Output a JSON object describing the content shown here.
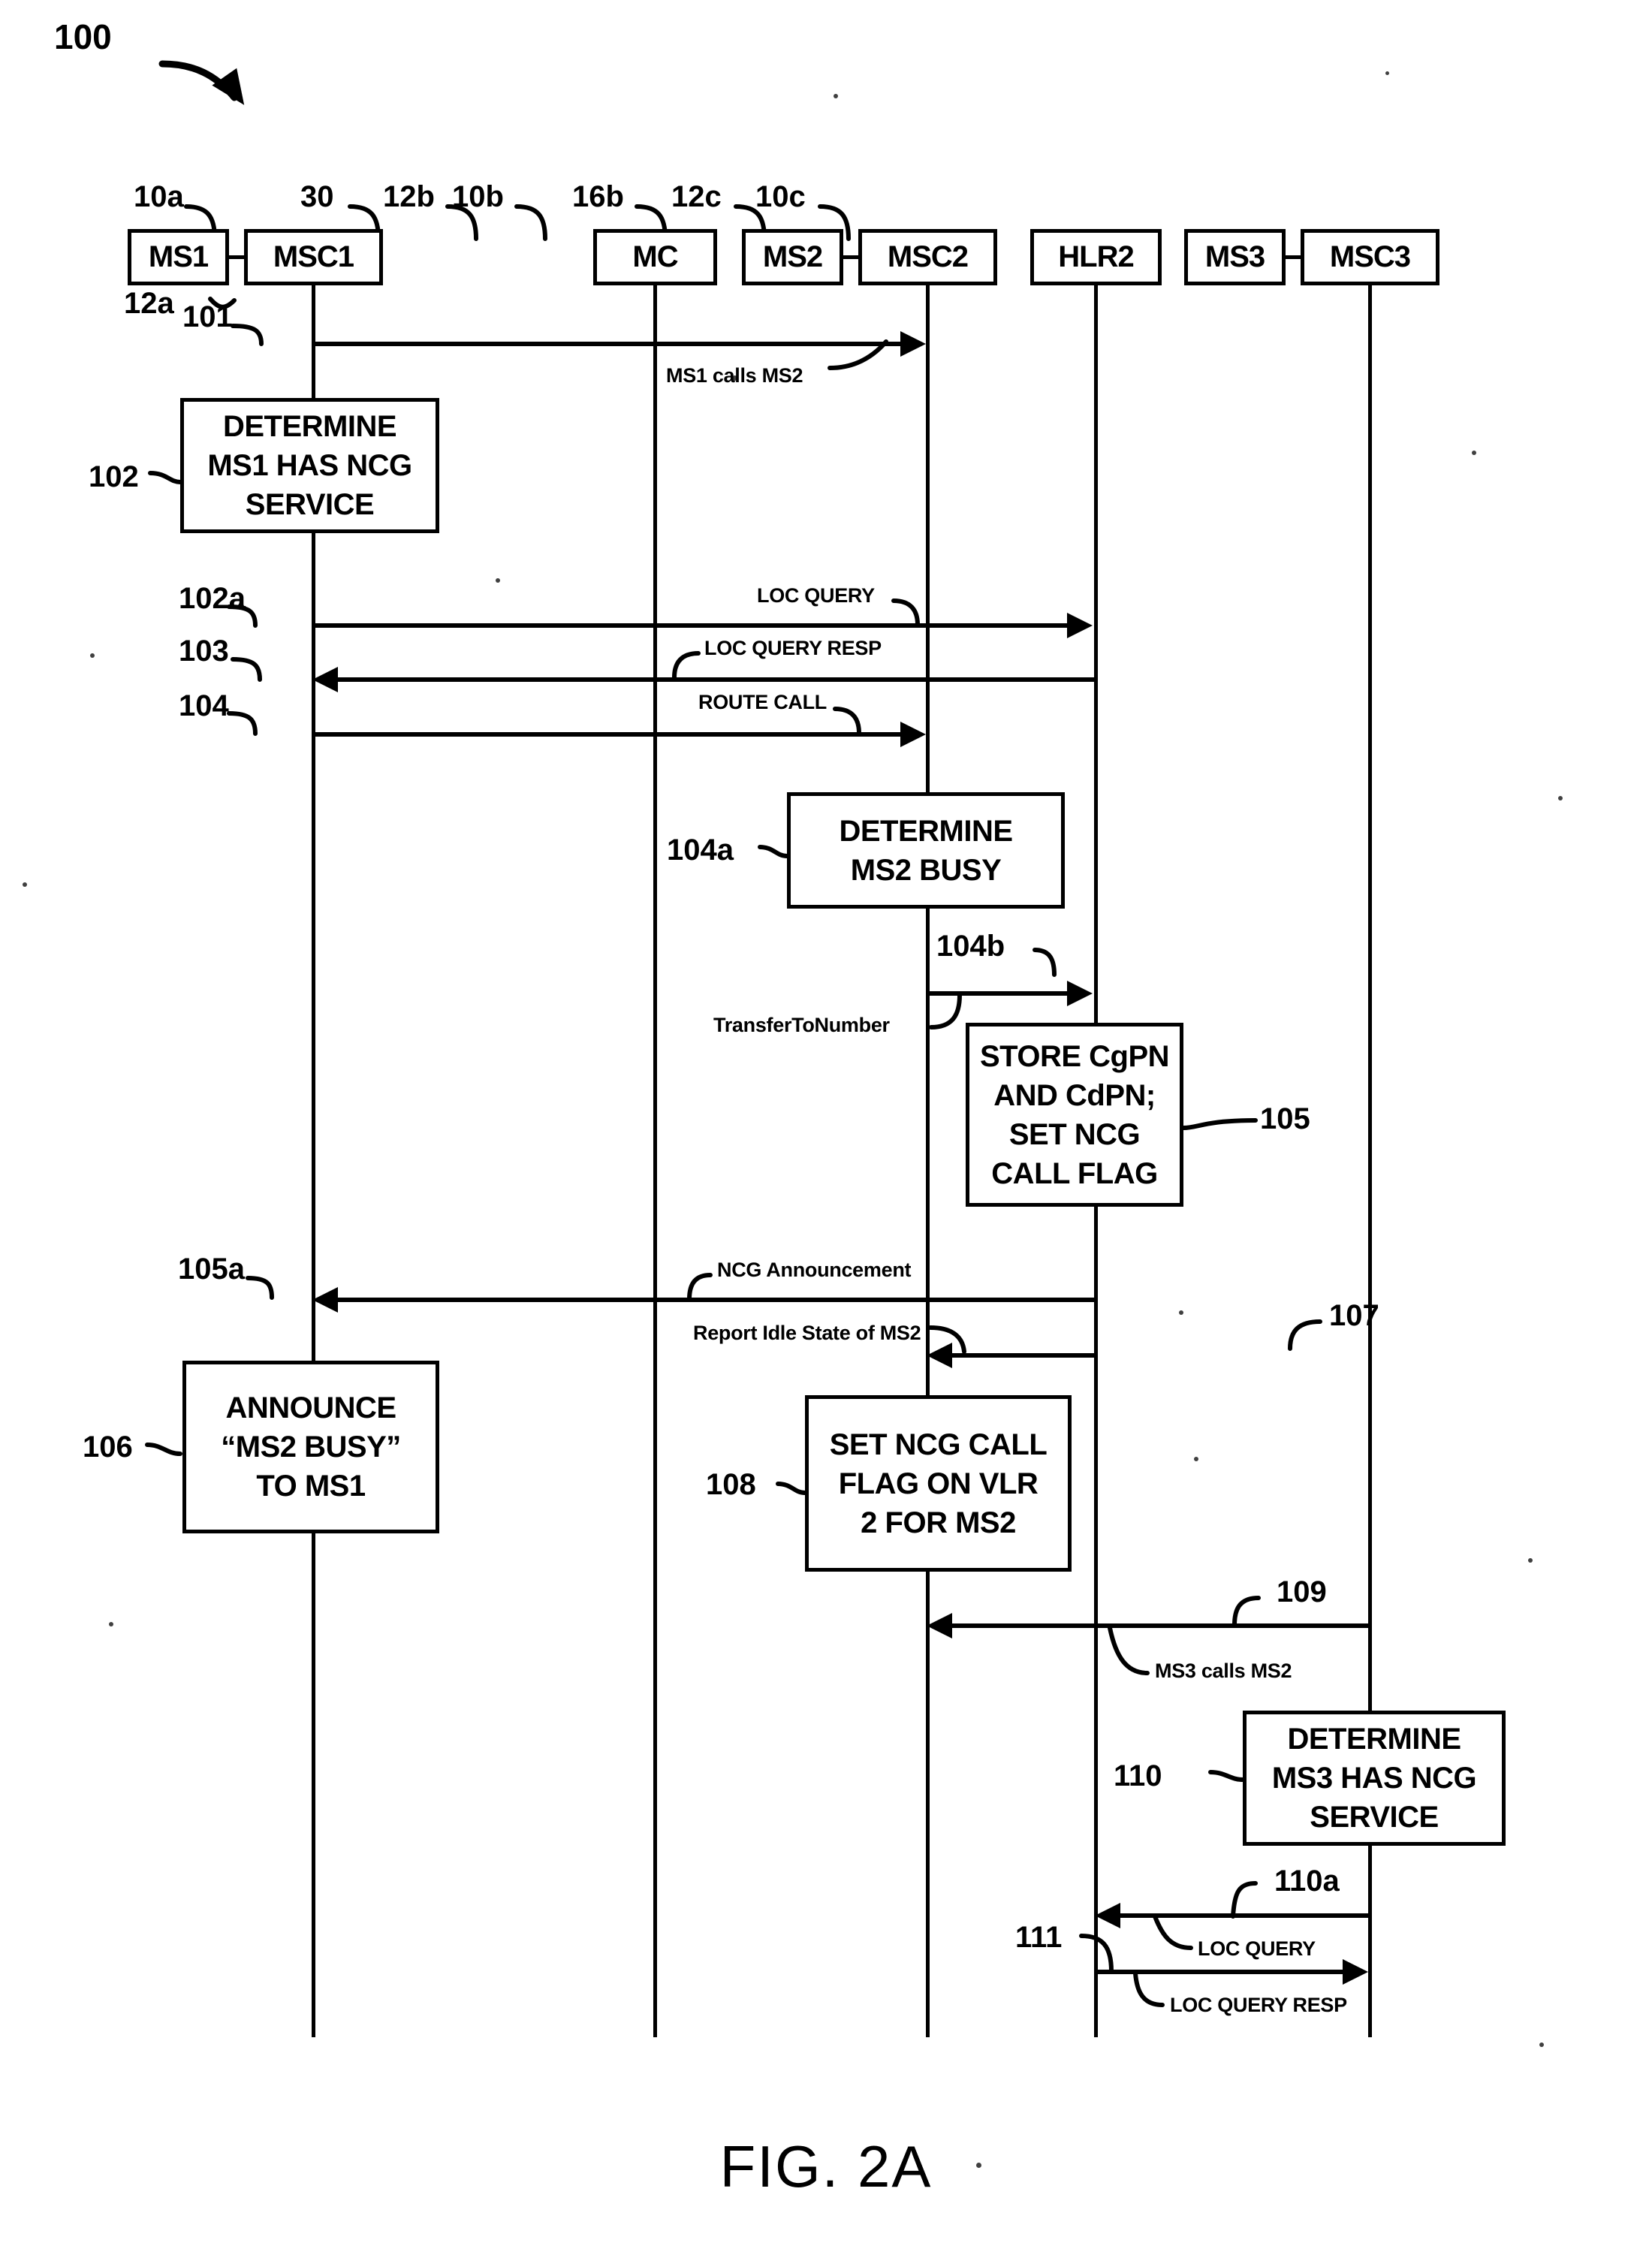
{
  "figure": {
    "caption": "FIG. 2A",
    "diagram_ref": "100",
    "type": "sequence-diagram"
  },
  "actors": [
    {
      "id": "ms1",
      "label": "MS1",
      "ref": "12a",
      "lifeline": false
    },
    {
      "id": "msc1",
      "label": "MSC1",
      "ref": "10a",
      "lifeline": true
    },
    {
      "id": "mc",
      "label": "MC",
      "ref": "30",
      "lifeline": true
    },
    {
      "id": "ms2",
      "label": "MS2",
      "ref": "12b",
      "lifeline": false
    },
    {
      "id": "msc2",
      "label": "MSC2",
      "ref": "10b",
      "lifeline": true
    },
    {
      "id": "hlr2",
      "label": "HLR2",
      "ref": "16b",
      "lifeline": true
    },
    {
      "id": "ms3",
      "label": "MS3",
      "ref": "12c",
      "lifeline": false
    },
    {
      "id": "msc3",
      "label": "MSC3",
      "ref": "10c",
      "lifeline": true
    }
  ],
  "process_boxes": [
    {
      "ref": "102",
      "lines": [
        "DETERMINE",
        "MS1 HAS NCG",
        "SERVICE"
      ],
      "on": "msc1"
    },
    {
      "ref": "104a",
      "lines": [
        "DETERMINE",
        "MS2 BUSY"
      ],
      "on": "msc2"
    },
    {
      "ref": "105",
      "lines": [
        "STORE CgPN",
        "AND CdPN;",
        "SET NCG",
        "CALL FLAG"
      ],
      "on": "hlr2"
    },
    {
      "ref": "106",
      "lines": [
        "ANNOUNCE",
        "“MS2 BUSY”",
        "TO MS1"
      ],
      "on": "msc1"
    },
    {
      "ref": "108",
      "lines": [
        "SET NCG CALL",
        "FLAG ON VLR",
        "2 FOR MS2"
      ],
      "on": "msc2"
    },
    {
      "ref": "110",
      "lines": [
        "DETERMINE",
        "MS3 HAS NCG",
        "SERVICE"
      ],
      "on": "msc3"
    }
  ],
  "messages": [
    {
      "ref": "101",
      "caption": "MS1 calls MS2",
      "from": "msc1",
      "to": "msc2",
      "direction": "right"
    },
    {
      "ref": "102a",
      "caption": "LOC QUERY",
      "from": "msc1",
      "to": "hlr2",
      "direction": "right"
    },
    {
      "ref": "103",
      "caption": "LOC QUERY RESP",
      "from": "hlr2",
      "to": "msc1",
      "direction": "left"
    },
    {
      "ref": "104",
      "caption": "ROUTE CALL",
      "from": "msc1",
      "to": "msc2",
      "direction": "right"
    },
    {
      "ref": "104b",
      "caption": "TransferToNumber",
      "from": "msc2",
      "to": "hlr2",
      "direction": "right"
    },
    {
      "ref": "105a",
      "caption": "NCG Announcement",
      "from": "hlr2",
      "to": "msc1",
      "direction": "left"
    },
    {
      "ref": "107",
      "caption": "Report Idle State of MS2",
      "from": "hlr2",
      "to": "msc2",
      "direction": "left"
    },
    {
      "ref": "109",
      "caption": "MS3 calls MS2",
      "from": "msc3",
      "to": "msc2",
      "direction": "left"
    },
    {
      "ref": "110a",
      "caption": "LOC QUERY",
      "from": "msc3",
      "to": "hlr2",
      "direction": "left"
    },
    {
      "ref": "111",
      "caption": "LOC QUERY RESP",
      "from": "hlr2",
      "to": "msc3",
      "direction": "right"
    }
  ],
  "colors": {
    "ink": "#000000",
    "paper": "#ffffff"
  }
}
